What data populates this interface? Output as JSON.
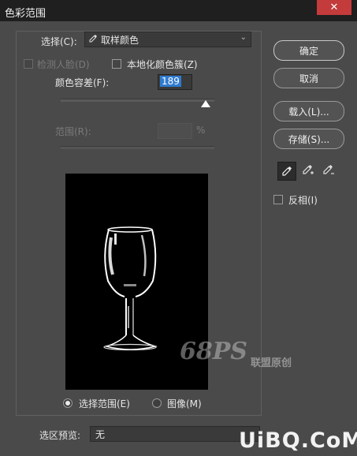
{
  "window": {
    "title": "色彩范围",
    "close_glyph": "✕"
  },
  "select": {
    "label": "选择(C):",
    "value": "取样颜色",
    "icon": "eyedropper-icon"
  },
  "detect_faces": {
    "label": "检测人脸(D)",
    "checked": false,
    "enabled": false
  },
  "localized_clusters": {
    "label": "本地化颜色簇(Z)",
    "checked": false
  },
  "fuzziness": {
    "label": "颜色容差(F):",
    "value": "189",
    "slider_fraction": 0.94
  },
  "range": {
    "label": "范围(R):",
    "value": "",
    "unit": "%",
    "enabled": false
  },
  "buttons": {
    "ok": "确定",
    "cancel": "取消",
    "load": "载入(L)...",
    "save": "存储(S)..."
  },
  "eyedroppers": [
    "eyedropper-icon",
    "add-to-sample-eyedropper-icon",
    "subtract-from-sample-eyedropper-icon"
  ],
  "invert": {
    "label": "反相(I)",
    "checked": false
  },
  "view_mode": {
    "selection_label": "选择范围(E)",
    "image_label": "图像(M)",
    "selected": "selection"
  },
  "selection_preview": {
    "label": "选区预览:",
    "value": "无"
  },
  "watermark": {
    "left_text": "68PS",
    "left_cn": "联盟原创",
    "bottom": "UiBQ.CoM"
  },
  "colors": {
    "dialog_bg": "#4a4a4a",
    "title_bg": "#1f1f1f",
    "accent": "#2f7bd0",
    "close": "#c43b3b"
  }
}
